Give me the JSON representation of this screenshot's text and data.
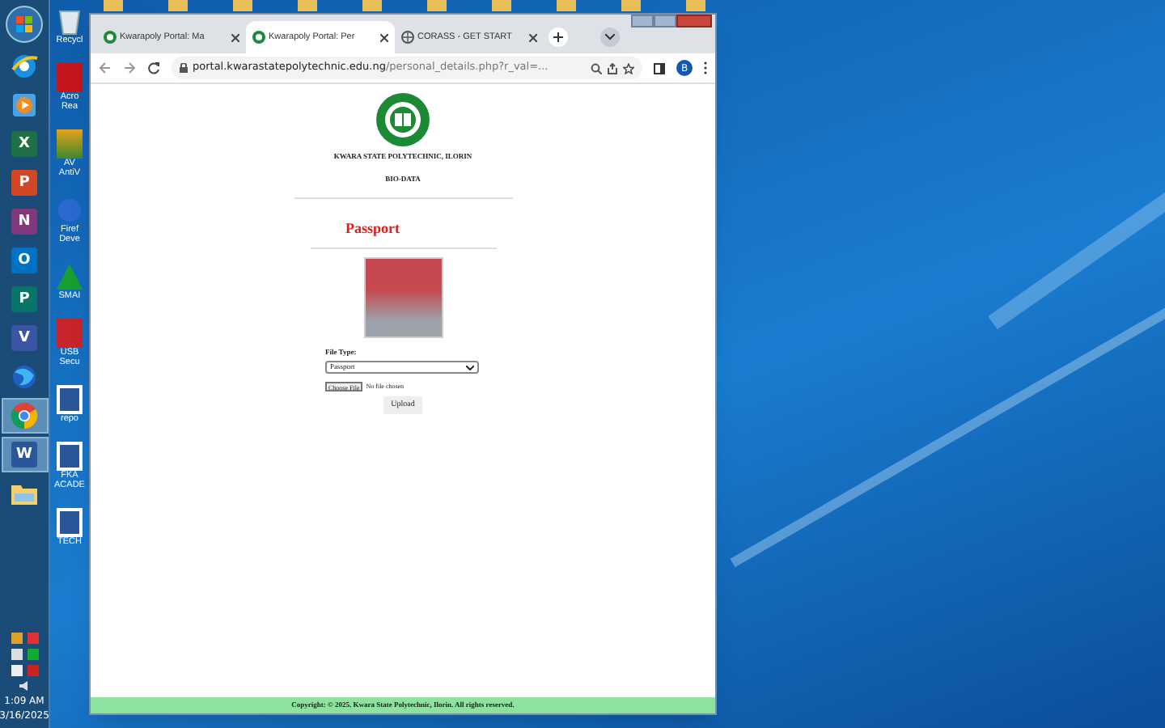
{
  "taskbar": {
    "items": [
      {
        "kind": "ie",
        "selected": false
      },
      {
        "kind": "media",
        "selected": false
      },
      {
        "kind": "office",
        "letter": "X",
        "color": "#1e7145",
        "selected": false
      },
      {
        "kind": "office",
        "letter": "P",
        "color": "#d24726",
        "selected": false
      },
      {
        "kind": "office",
        "letter": "N",
        "color": "#80397b",
        "selected": false
      },
      {
        "kind": "office",
        "letter": "O",
        "color": "#0072c6",
        "selected": false
      },
      {
        "kind": "office",
        "letter": "P",
        "color": "#077568",
        "selected": false
      },
      {
        "kind": "office",
        "letter": "V",
        "color": "#3955a3",
        "selected": false
      },
      {
        "kind": "firefox",
        "selected": false
      },
      {
        "kind": "chrome",
        "selected": true
      },
      {
        "kind": "office",
        "letter": "W",
        "color": "#2b579a",
        "selected": true
      },
      {
        "kind": "folder",
        "selected": false
      }
    ],
    "clock": {
      "time": "1:09 AM",
      "date": "3/16/2025"
    }
  },
  "desktop_icons": [
    {
      "kind": "recycle",
      "label": [
        "Recycl"
      ]
    },
    {
      "kind": "acrobat",
      "label": [
        "Acro",
        "Rea"
      ]
    },
    {
      "kind": "avira",
      "label": [
        "AV",
        "AntiV"
      ]
    },
    {
      "kind": "firefox",
      "label": [
        "Firef",
        "Deve"
      ]
    },
    {
      "kind": "smadav",
      "label": [
        "SMAI"
      ]
    },
    {
      "kind": "usb",
      "label": [
        "USB",
        "Secu"
      ]
    },
    {
      "kind": "word",
      "label": [
        "repo"
      ]
    },
    {
      "kind": "word",
      "label": [
        "FKA",
        "ACADE"
      ]
    },
    {
      "kind": "word",
      "label": [
        "TECH"
      ]
    }
  ],
  "browser": {
    "tabs": [
      {
        "title": "Kwarapoly Portal: Ma",
        "kind": "portal",
        "selected": false
      },
      {
        "title": "Kwarapoly Portal: Per",
        "kind": "portal",
        "selected": true
      },
      {
        "title": "CORASS - GET START",
        "kind": "globe",
        "selected": false
      }
    ],
    "url_host": "portal.kwarastatepolytechnic.edu.ng",
    "url_path": "/personal_details.php?r_val=...",
    "profile": "B"
  },
  "page": {
    "school": "KWARA STATE POLYTECHNIC, ILORIN",
    "subtitle": "BIO-DATA",
    "section": "Passport",
    "file_type_label": "File Type:",
    "file_type": "Passport",
    "choose_file": "Choose File",
    "no_file": "No file chosen",
    "upload": "Upload",
    "footer": "Copyright: © 2025. Kwara State Polytechnic, Ilorin. All rights reserved."
  }
}
